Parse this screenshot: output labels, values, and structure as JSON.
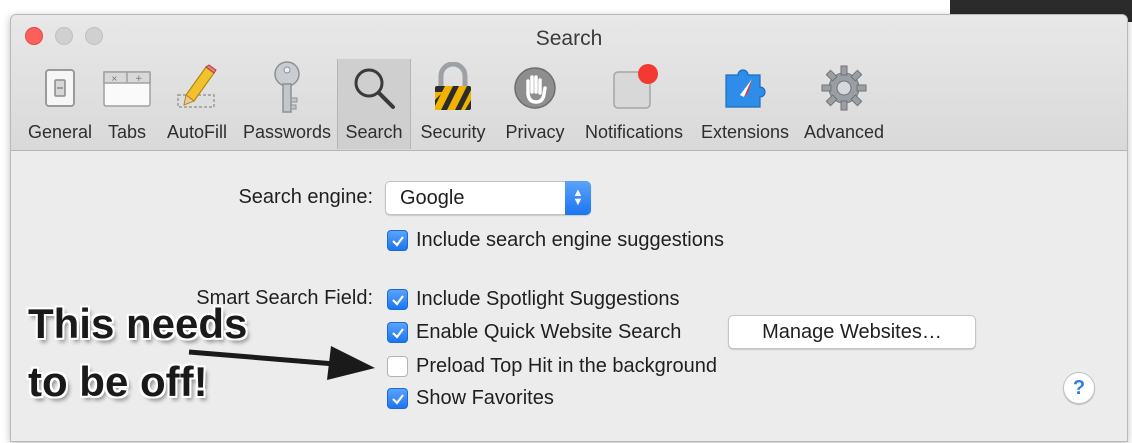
{
  "window": {
    "title": "Search"
  },
  "toolbar": {
    "items": [
      {
        "label": "General",
        "icon": "general-switch-icon"
      },
      {
        "label": "Tabs",
        "icon": "tabs-icon"
      },
      {
        "label": "AutoFill",
        "icon": "pencil-icon"
      },
      {
        "label": "Passwords",
        "icon": "key-icon"
      },
      {
        "label": "Search",
        "icon": "magnifier-icon",
        "selected": true
      },
      {
        "label": "Security",
        "icon": "lock-icon"
      },
      {
        "label": "Privacy",
        "icon": "hand-icon"
      },
      {
        "label": "Notifications",
        "icon": "notification-badge-icon"
      },
      {
        "label": "Extensions",
        "icon": "puzzle-compass-icon"
      },
      {
        "label": "Advanced",
        "icon": "gear-icon"
      }
    ]
  },
  "search": {
    "engine_label": "Search engine:",
    "engine_value": "Google",
    "include_suggestions": {
      "label": "Include search engine suggestions",
      "checked": true
    }
  },
  "smart_field": {
    "label": "Smart Search Field:",
    "spotlight": {
      "label": "Include Spotlight Suggestions",
      "checked": true
    },
    "quick_search": {
      "label": "Enable Quick Website Search",
      "checked": true
    },
    "manage_button": "Manage Websites…",
    "preload": {
      "label": "Preload Top Hit in the background",
      "checked": false
    },
    "favorites": {
      "label": "Show Favorites",
      "checked": true
    }
  },
  "help": "?",
  "annotation": {
    "line1": "This needs",
    "line2": "to be off!"
  },
  "colors": {
    "accent": "#1c75f0",
    "close": "#fc605c",
    "security_stripe": "#f0b400"
  }
}
